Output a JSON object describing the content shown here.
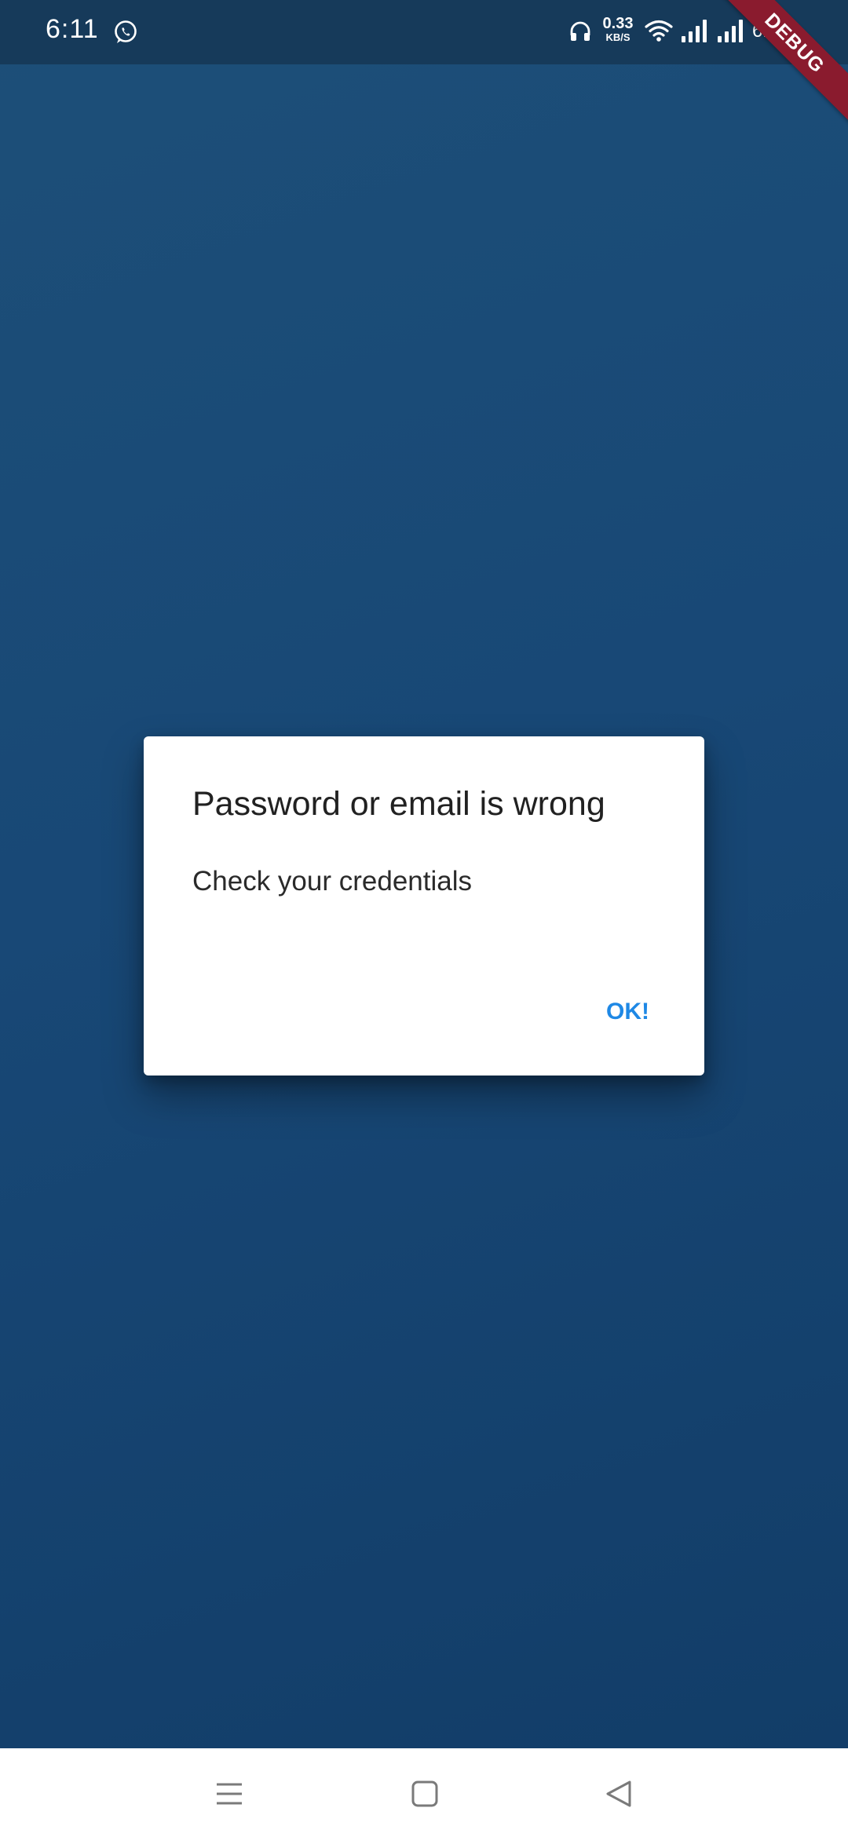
{
  "status_bar": {
    "time": "6:11",
    "net_speed_value": "0.33",
    "net_speed_unit": "KB/S",
    "battery": "61%",
    "icons": [
      "whatsapp-icon",
      "headphones-icon",
      "wifi-icon",
      "signal-icon",
      "signal-icon",
      "charging-icon"
    ]
  },
  "debug_banner": "DEBUG",
  "dialog": {
    "title": "Password or email is wrong",
    "message": "Check your credentials",
    "ok_label": "OK!",
    "accent_color": "#1e88e5"
  },
  "nav_bar": {
    "icons": [
      "menu-icon",
      "home-icon",
      "back-icon"
    ]
  },
  "colors": {
    "background": "#184876",
    "status_bar": "#163a5a",
    "debug_banner": "#8a1b2e"
  }
}
